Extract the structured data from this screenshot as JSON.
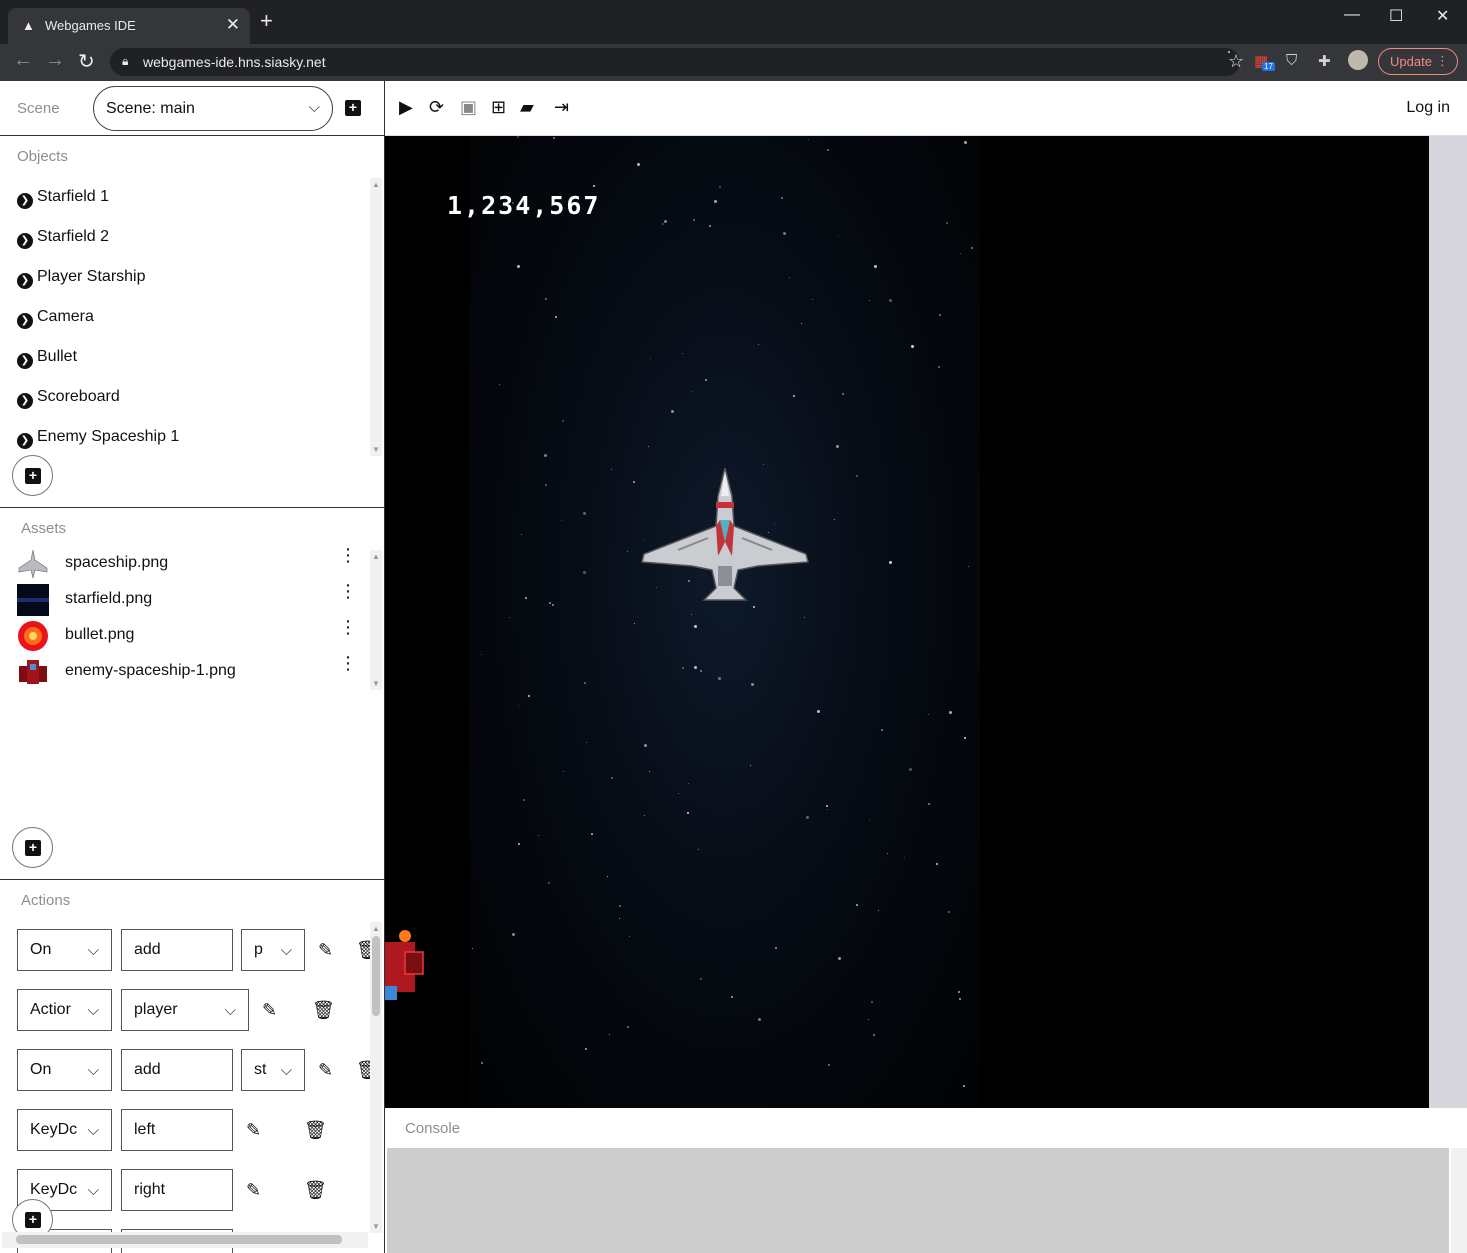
{
  "browser": {
    "tab_title": "Webgames IDE",
    "tab_close": "✕",
    "new_tab": "+",
    "url": "webgames-ide.hns.siasky.net",
    "extension_badge": "17",
    "update_label": "Update",
    "window_controls": {
      "minimize": "—",
      "maximize": "☐",
      "close": "✕"
    }
  },
  "scene": {
    "label": "Scene",
    "selected": "Scene: main"
  },
  "objects": {
    "title": "Objects",
    "items": [
      {
        "label": "Starfield 1"
      },
      {
        "label": "Starfield 2"
      },
      {
        "label": "Player Starship"
      },
      {
        "label": "Camera"
      },
      {
        "label": "Bullet"
      },
      {
        "label": "Scoreboard"
      },
      {
        "label": "Enemy Spaceship 1"
      }
    ]
  },
  "assets": {
    "title": "Assets",
    "items": [
      {
        "name": "spaceship.png"
      },
      {
        "name": "starfield.png"
      },
      {
        "name": "bullet.png"
      },
      {
        "name": "enemy-spaceship-1.png"
      }
    ]
  },
  "actions": {
    "title": "Actions",
    "rows": [
      {
        "trigger": "On",
        "arg": "add",
        "target": "p"
      },
      {
        "trigger": "Actior",
        "arg": "player"
      },
      {
        "trigger": "On",
        "arg": "add",
        "target": "st"
      },
      {
        "trigger": "KeyDc",
        "arg": "left"
      },
      {
        "trigger": "KeyDc",
        "arg": "right"
      }
    ]
  },
  "toolbar": {
    "login_label": "Log in",
    "icons": [
      "play-icon",
      "refresh-icon",
      "save-icon",
      "new-file-icon",
      "open-folder-icon",
      "export-icon"
    ]
  },
  "game": {
    "score": "1,234,567"
  },
  "console": {
    "title": "Console"
  },
  "colors": {
    "chrome_dark": "#202124",
    "chrome_toolbar": "#35363a",
    "update_accent": "#f28b82",
    "canvas_bg": "#000000"
  }
}
